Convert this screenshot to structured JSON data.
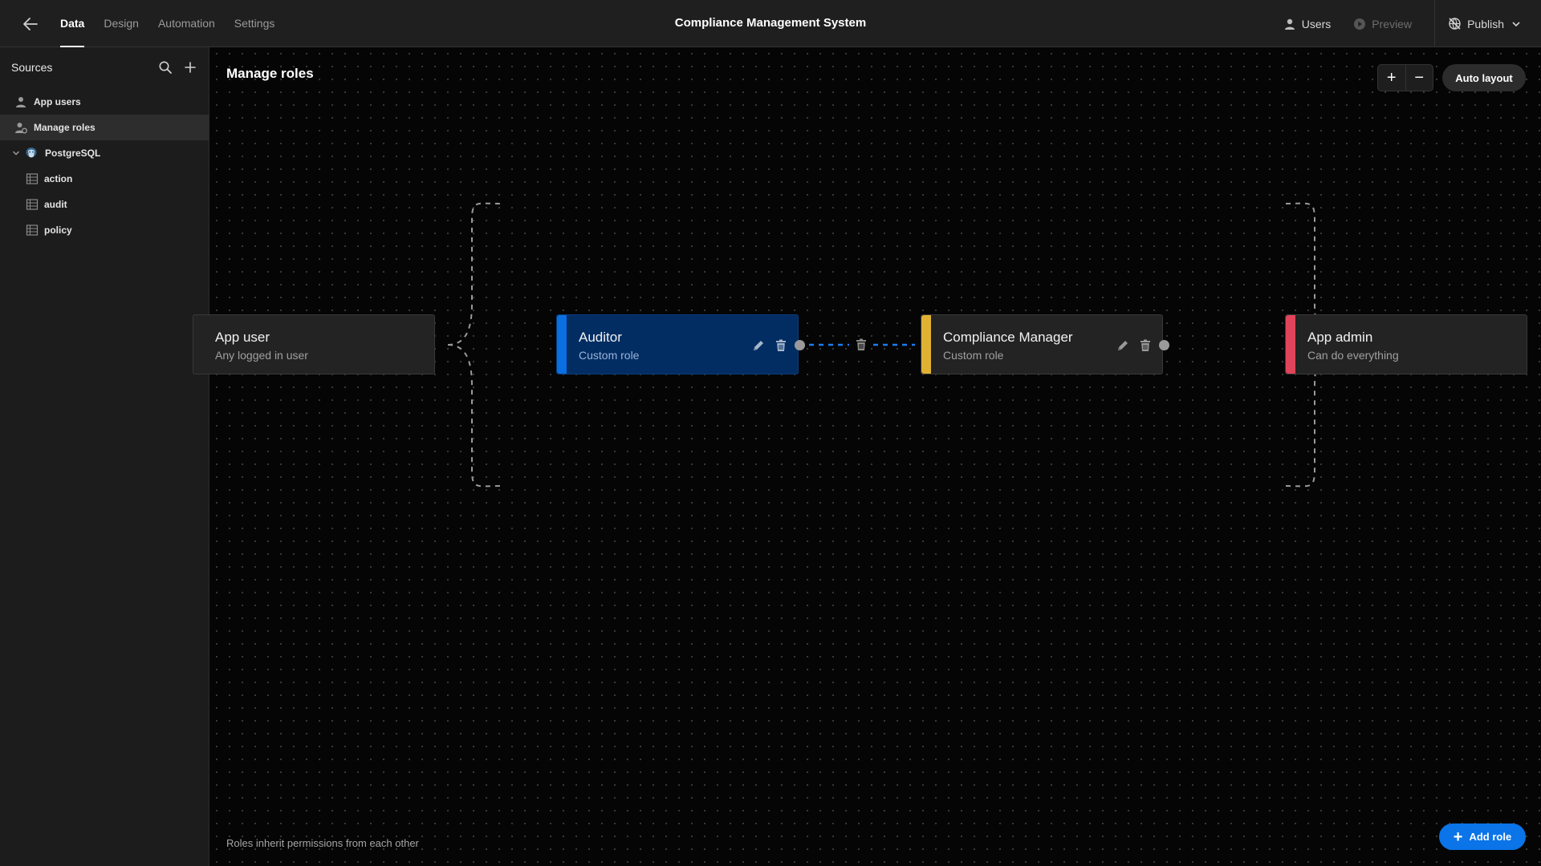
{
  "topbar": {
    "tabs": [
      {
        "label": "Data",
        "active": true
      },
      {
        "label": "Design",
        "active": false
      },
      {
        "label": "Automation",
        "active": false
      },
      {
        "label": "Settings",
        "active": false
      }
    ],
    "app_title": "Compliance Management System",
    "users_label": "Users",
    "preview_label": "Preview",
    "publish_label": "Publish"
  },
  "sidebar": {
    "title": "Sources",
    "items": [
      {
        "label": "App users",
        "icon": "user-icon"
      },
      {
        "label": "Manage roles",
        "icon": "roles-icon",
        "selected": true
      },
      {
        "label": "PostgreSQL",
        "icon": "postgresql-icon",
        "expanded": true
      },
      {
        "label": "action",
        "icon": "table-icon"
      },
      {
        "label": "audit",
        "icon": "table-icon"
      },
      {
        "label": "policy",
        "icon": "table-icon"
      }
    ]
  },
  "canvas": {
    "title": "Manage roles",
    "zoom_in": "+",
    "zoom_out": "−",
    "auto_layout_label": "Auto layout",
    "footnote": "Roles inherit permissions from each other",
    "add_role_label": "Add role",
    "roles": [
      {
        "name": "App user",
        "description": "Any logged in user",
        "color": null
      },
      {
        "name": "Auditor",
        "description": "Custom role",
        "color": "#0a6fe0",
        "selected": true
      },
      {
        "name": "Compliance Manager",
        "description": "Custom role",
        "color": "#e0b233"
      },
      {
        "name": "App admin",
        "description": "Can do everything",
        "color": "#e0445a"
      }
    ]
  },
  "colors": {
    "accent": "#0a74e8",
    "auditor": "#0a6fe0",
    "compliance_manager": "#e0b233",
    "app_admin": "#e0445a"
  }
}
